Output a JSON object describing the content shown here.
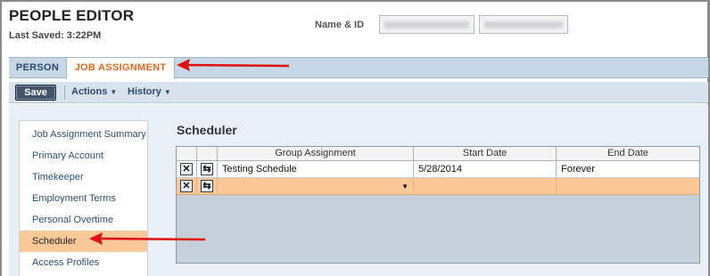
{
  "header": {
    "title": "PEOPLE EDITOR",
    "last_saved": "Last Saved: 3:22PM",
    "name_id_label": "Name & ID"
  },
  "tabs": [
    {
      "label": "PERSON",
      "active": false
    },
    {
      "label": "JOB ASSIGNMENT",
      "active": true
    }
  ],
  "toolbar": {
    "save_label": "Save",
    "actions_label": "Actions",
    "history_label": "History"
  },
  "sidebar": {
    "items": [
      {
        "label": "Job Assignment Summary",
        "active": false
      },
      {
        "label": "Primary Account",
        "active": false
      },
      {
        "label": "Timekeeper",
        "active": false
      },
      {
        "label": "Employment Terms",
        "active": false
      },
      {
        "label": "Personal Overtime",
        "active": false
      },
      {
        "label": "Scheduler",
        "active": true
      },
      {
        "label": "Access Profiles",
        "active": false
      }
    ]
  },
  "main": {
    "section_title": "Scheduler",
    "grid": {
      "columns": [
        "Group Assignment",
        "Start Date",
        "End Date"
      ],
      "rows": [
        {
          "group": "Testing Schedule",
          "start": "5/28/2014",
          "end": "Forever"
        },
        {
          "group": "",
          "start": "",
          "end": ""
        }
      ]
    }
  },
  "icons": {
    "delete": "close-icon",
    "edit": "edit-icon",
    "dropdown": "caret-down-icon"
  },
  "colors": {
    "accent_orange": "#e2681c",
    "selected_row": "#fbc997",
    "annotation_arrow": "#e01010"
  }
}
